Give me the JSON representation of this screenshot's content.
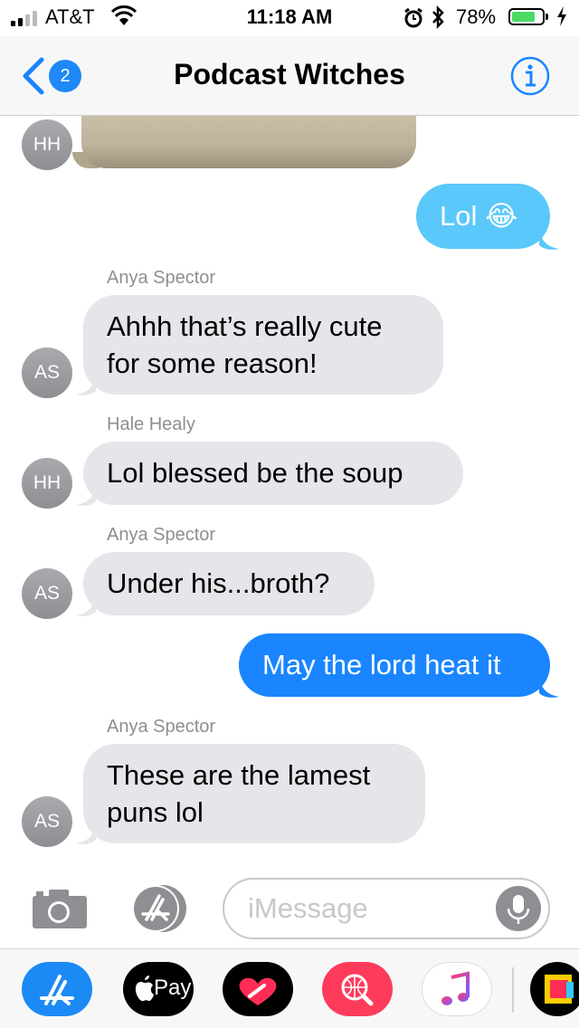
{
  "status_bar": {
    "carrier": "AT&T",
    "time": "11:18 AM",
    "battery_pct": "78%",
    "battery_level": 0.78,
    "icons": [
      "signal-icon",
      "wifi-icon",
      "alarm-icon",
      "bluetooth-icon",
      "battery-icon",
      "charging-bolt-icon"
    ]
  },
  "nav": {
    "back_badge": "2",
    "title": "Podcast Witches",
    "info_icon": "info-icon"
  },
  "messages": [
    {
      "type": "photo",
      "avatar": "HH"
    },
    {
      "type": "outgoing-sms",
      "text": "Lol 😂"
    },
    {
      "type": "incoming",
      "sender": "Anya Spector",
      "avatar": "AS",
      "lines": [
        "Ahhh that’s really cute",
        "for some reason!"
      ]
    },
    {
      "type": "incoming",
      "sender": "Hale Healy",
      "avatar": "HH",
      "lines": [
        "Lol blessed be the soup"
      ]
    },
    {
      "type": "incoming",
      "sender": "Anya Spector",
      "avatar": "AS",
      "lines": [
        "Under his...broth?"
      ]
    },
    {
      "type": "outgoing-imessage",
      "text": "May the lord heat it"
    },
    {
      "type": "incoming",
      "sender": "Anya Spector",
      "avatar": "AS",
      "lines": [
        "These are the lamest",
        "puns lol"
      ]
    }
  ],
  "input": {
    "placeholder": "iMessage",
    "icons": [
      "camera-icon",
      "app-store-icon",
      "microphone-icon"
    ]
  },
  "drawer": {
    "apps": [
      "App Store",
      "Apple Pay",
      "Digital Touch",
      "Images Search",
      "Music",
      "Sticker App"
    ],
    "applepay_label": "Pay"
  },
  "colors": {
    "imessage_blue": "#1a85ff",
    "sms_blue": "#5ac8fa",
    "incoming_gray": "#e5e5ea",
    "avatar_gray": "#8e8e93"
  }
}
